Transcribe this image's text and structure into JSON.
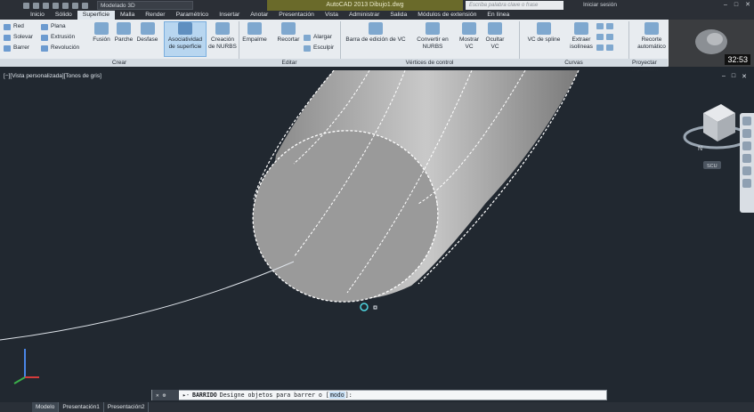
{
  "title_bar": {
    "workspace": "Modelado 3D",
    "document": "AutoCAD 2013    Dibujo1.dwg",
    "search_placeholder": "Escriba palabra clave o frase",
    "signin": "Iniciar sesión"
  },
  "tabs": [
    "Inicio",
    "Sólido",
    "Superficie",
    "Malla",
    "Render",
    "Paramétrico",
    "Insertar",
    "Anotar",
    "Presentación",
    "Vista",
    "Administrar",
    "Salida",
    "Módulos de extensión",
    "En línea"
  ],
  "active_tab": "Superficie",
  "ribbon": {
    "crear_small": [
      "Red",
      "Solevar",
      "Barrer",
      "Plana",
      "Extrusión",
      "Revolución"
    ],
    "buttons": {
      "fusion": "Fusión",
      "parche": "Parche",
      "desfase": "Desfase",
      "asociatividad_1": "Asociatividad",
      "asociatividad_2": "de superficie",
      "creacion_1": "Creación",
      "creacion_2": "de NURBS",
      "empalme": "Empalme",
      "recortar": "Recortar",
      "alargar": "Alargar",
      "esculpir": "Esculpir",
      "barra_edicion": "Barra de edición de VC",
      "convertir_1": "Convertir en",
      "convertir_2": "NURBS",
      "mostrar_1": "Mostrar",
      "mostrar_2": "VC",
      "ocultar_1": "Ocultar",
      "ocultar_2": "VC",
      "vc_spline": "VC de spline",
      "extraer_1": "Extraer",
      "extraer_2": "isolíneas",
      "recorte_1": "Recorte",
      "recorte_2": "automático"
    },
    "panels": [
      "Crear",
      "Editar",
      "Vértices de control",
      "Curvas",
      "Proyectar geometría"
    ]
  },
  "video": {
    "time": "32:53"
  },
  "viewport": {
    "label": "[−][Vista personalizada][Tonos de gris]",
    "viewcube_label": "N",
    "wcs": "SCU"
  },
  "command": {
    "prefix": "-",
    "keyword": "BARRIDO",
    "prompt": "Designe objetos para barrer o [",
    "option": "modo",
    "suffix": "]:"
  },
  "layout_tabs": [
    "Modelo",
    "Presentación1",
    "Presentación2"
  ],
  "colors": {
    "viewport_bg": "#212830",
    "accent": "#7aaede"
  }
}
